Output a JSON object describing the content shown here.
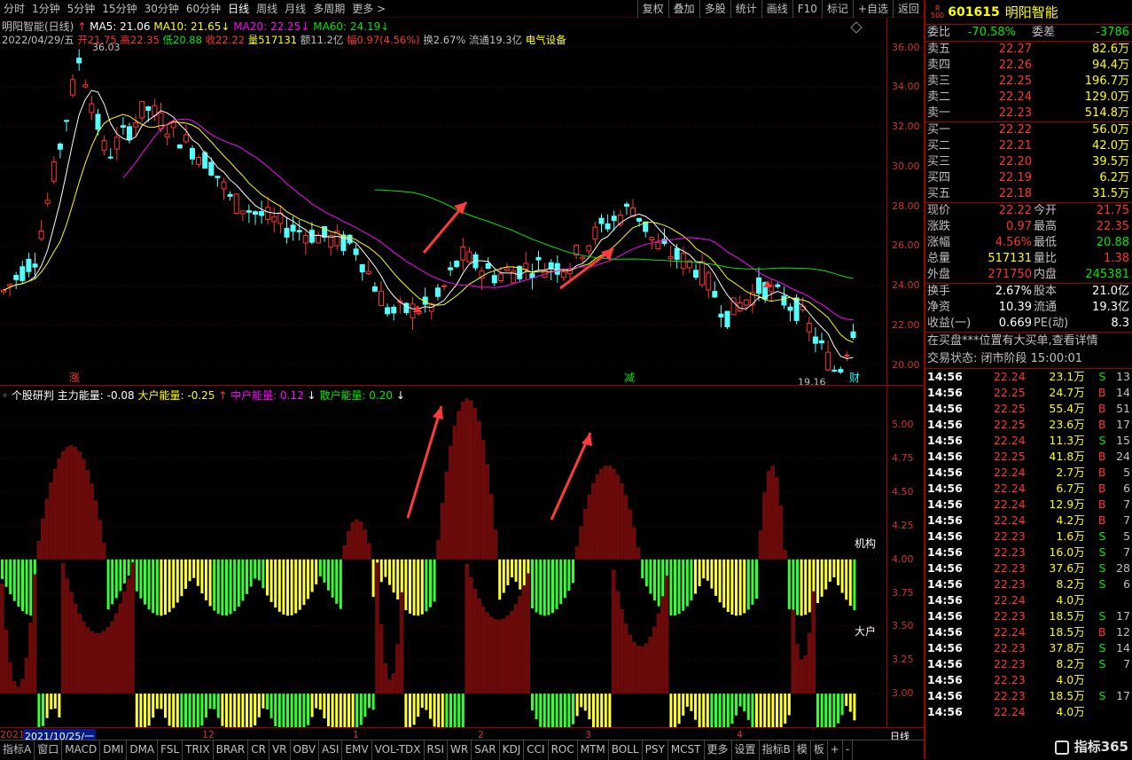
{
  "toolbar": {
    "items": [
      "分时",
      "1分钟",
      "5分钟",
      "15分钟",
      "30分钟",
      "60分钟",
      "日线",
      "周线",
      "月线",
      "多周期",
      "更多 >"
    ],
    "right": [
      "复权",
      "叠加",
      "多股",
      "统计",
      "画线",
      "F10",
      "标记",
      "+自选",
      "返回"
    ]
  },
  "header": {
    "name": "明阳智能(日线)",
    "ma5_label": "MA5: 21.06",
    "ma10_label": "MA10: 21.65",
    "ma20_label": "MA20: 22.25",
    "ma60_label": "MA60: 24.19",
    "date": "2022/04/29/五",
    "open": "开21.75",
    "high": "高22.35",
    "low": "低20.88",
    "close": "收22.22",
    "volume": "量517131",
    "amount": "额11.2亿",
    "change": "幅0.97(4.56%)",
    "turnover": "换2.67%",
    "float": "流通19.3亿",
    "sector": "电气设备"
  },
  "chart_data": [
    {
      "type": "candlestick",
      "title": "",
      "ylim": [
        19.0,
        37.5
      ],
      "yticks": [
        "36.00",
        "34.00",
        "32.00",
        "30.00",
        "28.00",
        "26.00",
        "24.00",
        "22.00",
        "20.00"
      ],
      "annotations": [
        "36.03",
        "19.16",
        "涨",
        "减",
        "财"
      ],
      "series_names": [
        "MA5",
        "MA10",
        "MA20",
        "MA60"
      ],
      "colors": {
        "up": "#ff3232",
        "down": "#54ffff",
        "ma5": "#ffffff",
        "ma10": "#ffff00",
        "ma20": "#ff00ff",
        "ma60": "#00e600"
      }
    },
    {
      "type": "bar",
      "title": "个股研判",
      "series_labels": [
        "主力能量: -0.08",
        "大户能量: -0.25",
        "中户能量: 0.12",
        "散户能量: 0.20"
      ],
      "ylim": [
        2.75,
        5.3
      ],
      "yticks": [
        "5.00",
        "4.75",
        "4.50",
        "4.25",
        "4.00",
        "3.75",
        "3.50",
        "3.25",
        "3.00"
      ],
      "labels": [
        "机构",
        "大户"
      ]
    }
  ],
  "xaxis": {
    "labels": [
      "2021",
      "2021/10/25/一",
      "12",
      "1",
      "2",
      "3",
      "4"
    ],
    "right_label": "日线"
  },
  "tabs": [
    "指标A",
    "窗口",
    "MACD",
    "DMI",
    "DMA",
    "FSL",
    "TRIX",
    "BRAR",
    "CR",
    "VR",
    "OBV",
    "ASI",
    "EMV",
    "VOL-TDX",
    "RSI",
    "WR",
    "SAR",
    "KDJ",
    "CCI",
    "ROC",
    "MTM",
    "BOLL",
    "PSY",
    "MCST",
    "更多",
    "设置",
    "指标B",
    "模",
    "板",
    "+",
    "-"
  ],
  "stock": {
    "code": "601615",
    "name": "明阳智能",
    "badge": "R",
    "badge_num": "500"
  },
  "quote": {
    "weibi_label": "委比",
    "weibi": "-70.58%",
    "weicha_label": "委差",
    "weicha": "-3786",
    "asks": [
      {
        "label": "卖五",
        "price": "22.27",
        "vol": "82.6万"
      },
      {
        "label": "卖四",
        "price": "22.26",
        "vol": "94.4万"
      },
      {
        "label": "卖三",
        "price": "22.25",
        "vol": "196.7万"
      },
      {
        "label": "卖二",
        "price": "22.24",
        "vol": "129.0万"
      },
      {
        "label": "卖一",
        "price": "22.23",
        "vol": "514.8万"
      }
    ],
    "bids": [
      {
        "label": "买一",
        "price": "22.22",
        "vol": "56.0万"
      },
      {
        "label": "买二",
        "price": "22.21",
        "vol": "42.0万"
      },
      {
        "label": "买三",
        "price": "22.20",
        "vol": "39.5万"
      },
      {
        "label": "买四",
        "price": "22.19",
        "vol": "6.2万"
      },
      {
        "label": "买五",
        "price": "22.18",
        "vol": "31.5万"
      }
    ],
    "stats": [
      {
        "l1": "现价",
        "v1": "22.22",
        "l2": "今开",
        "v2": "21.75",
        "c1": "#ff3232",
        "c2": "#ff3232"
      },
      {
        "l1": "涨跌",
        "v1": "0.97",
        "l2": "最高",
        "v2": "22.35",
        "c1": "#ff3232",
        "c2": "#ff3232"
      },
      {
        "l1": "涨幅",
        "v1": "4.56%",
        "l2": "最低",
        "v2": "20.88",
        "c1": "#ff3232",
        "c2": "#00e600"
      },
      {
        "l1": "总量",
        "v1": "517131",
        "l2": "量比",
        "v2": "1.38",
        "c1": "#ffff00",
        "c2": "#ff3232"
      },
      {
        "l1": "外盘",
        "v1": "271750",
        "l2": "内盘",
        "v2": "245381",
        "c1": "#ff3232",
        "c2": "#00e600"
      }
    ],
    "stats2": [
      {
        "l1": "换手",
        "v1": "2.67%",
        "l2": "股本",
        "v2": "21.0亿"
      },
      {
        "l1": "净资",
        "v1": "10.39",
        "l2": "流通",
        "v2": "19.3亿"
      },
      {
        "l1": "收益(一)",
        "v1": "0.669",
        "l2": "PE(动)",
        "v2": "8.3"
      }
    ],
    "message": "在买盘***位置有大买单,查看详情",
    "status": "交易状态: 闭市阶段 15:00:01"
  },
  "ticks": [
    {
      "t": "14:56",
      "p": "22.24",
      "v": "23.1万",
      "bs": "S",
      "n": "13"
    },
    {
      "t": "14:56",
      "p": "22.25",
      "v": "24.7万",
      "bs": "B",
      "n": "14"
    },
    {
      "t": "14:56",
      "p": "22.25",
      "v": "55.4万",
      "bs": "B",
      "n": "51"
    },
    {
      "t": "14:56",
      "p": "22.25",
      "v": "23.6万",
      "bs": "B",
      "n": "17"
    },
    {
      "t": "14:56",
      "p": "22.24",
      "v": "11.3万",
      "bs": "S",
      "n": "15"
    },
    {
      "t": "14:56",
      "p": "22.25",
      "v": "41.8万",
      "bs": "B",
      "n": "24"
    },
    {
      "t": "14:56",
      "p": "22.24",
      "v": "2.7万",
      "bs": "B",
      "n": "5"
    },
    {
      "t": "14:56",
      "p": "22.24",
      "v": "6.7万",
      "bs": "B",
      "n": "6"
    },
    {
      "t": "14:56",
      "p": "22.24",
      "v": "12.9万",
      "bs": "B",
      "n": "7"
    },
    {
      "t": "14:56",
      "p": "22.24",
      "v": "4.2万",
      "bs": "B",
      "n": "7"
    },
    {
      "t": "14:56",
      "p": "22.23",
      "v": "1.6万",
      "bs": "S",
      "n": "5"
    },
    {
      "t": "14:56",
      "p": "22.23",
      "v": "16.0万",
      "bs": "S",
      "n": "7"
    },
    {
      "t": "14:56",
      "p": "22.23",
      "v": "37.6万",
      "bs": "S",
      "n": "28"
    },
    {
      "t": "14:56",
      "p": "22.23",
      "v": "8.2万",
      "bs": "S",
      "n": "6"
    },
    {
      "t": "14:56",
      "p": "22.24",
      "v": "4.0万",
      "bs": "",
      "n": ""
    },
    {
      "t": "14:56",
      "p": "22.23",
      "v": "18.5万",
      "bs": "S",
      "n": "17"
    },
    {
      "t": "14:56",
      "p": "22.24",
      "v": "18.5万",
      "bs": "B",
      "n": "12"
    },
    {
      "t": "14:56",
      "p": "22.23",
      "v": "37.8万",
      "bs": "S",
      "n": "14"
    },
    {
      "t": "14:56",
      "p": "22.23",
      "v": "8.2万",
      "bs": "S",
      "n": "7"
    },
    {
      "t": "14:56",
      "p": "22.23",
      "v": "4.0万",
      "bs": "",
      "n": ""
    },
    {
      "t": "14:56",
      "p": "22.23",
      "v": "18.5万",
      "bs": "S",
      "n": "17"
    },
    {
      "t": "14:56",
      "p": "22.24",
      "v": "4.0万",
      "bs": "",
      "n": ""
    }
  ],
  "watermark": "指标365"
}
